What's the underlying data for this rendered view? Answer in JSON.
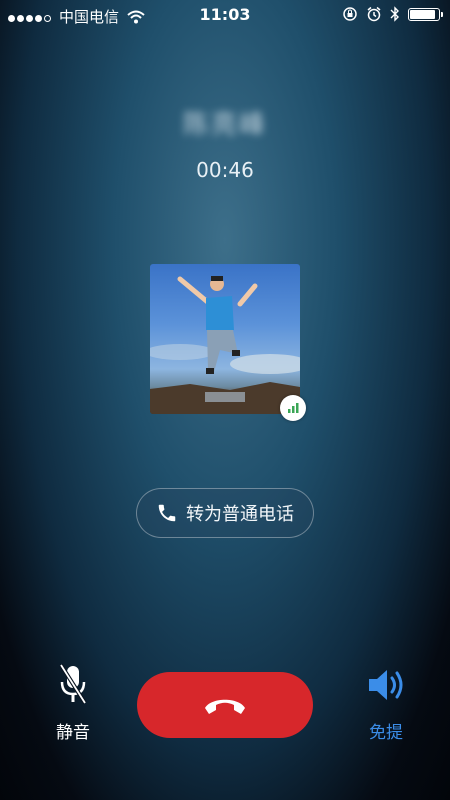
{
  "status_bar": {
    "carrier": "中国电信",
    "time": "11:03",
    "signal_dots": 4,
    "battery_level": 0.9
  },
  "call": {
    "caller_name": "陈亮峰",
    "duration": "00:46"
  },
  "actions": {
    "switch_to_normal_call": "转为普通电话",
    "mute_label": "静音",
    "speaker_label": "免提"
  },
  "colors": {
    "hangup": "#d7272b",
    "speaker_active": "#3b8de8"
  },
  "icons": {
    "mute": "microphone-off-icon",
    "hangup": "phone-hangup-icon",
    "speaker": "speaker-icon",
    "phone": "phone-icon"
  }
}
